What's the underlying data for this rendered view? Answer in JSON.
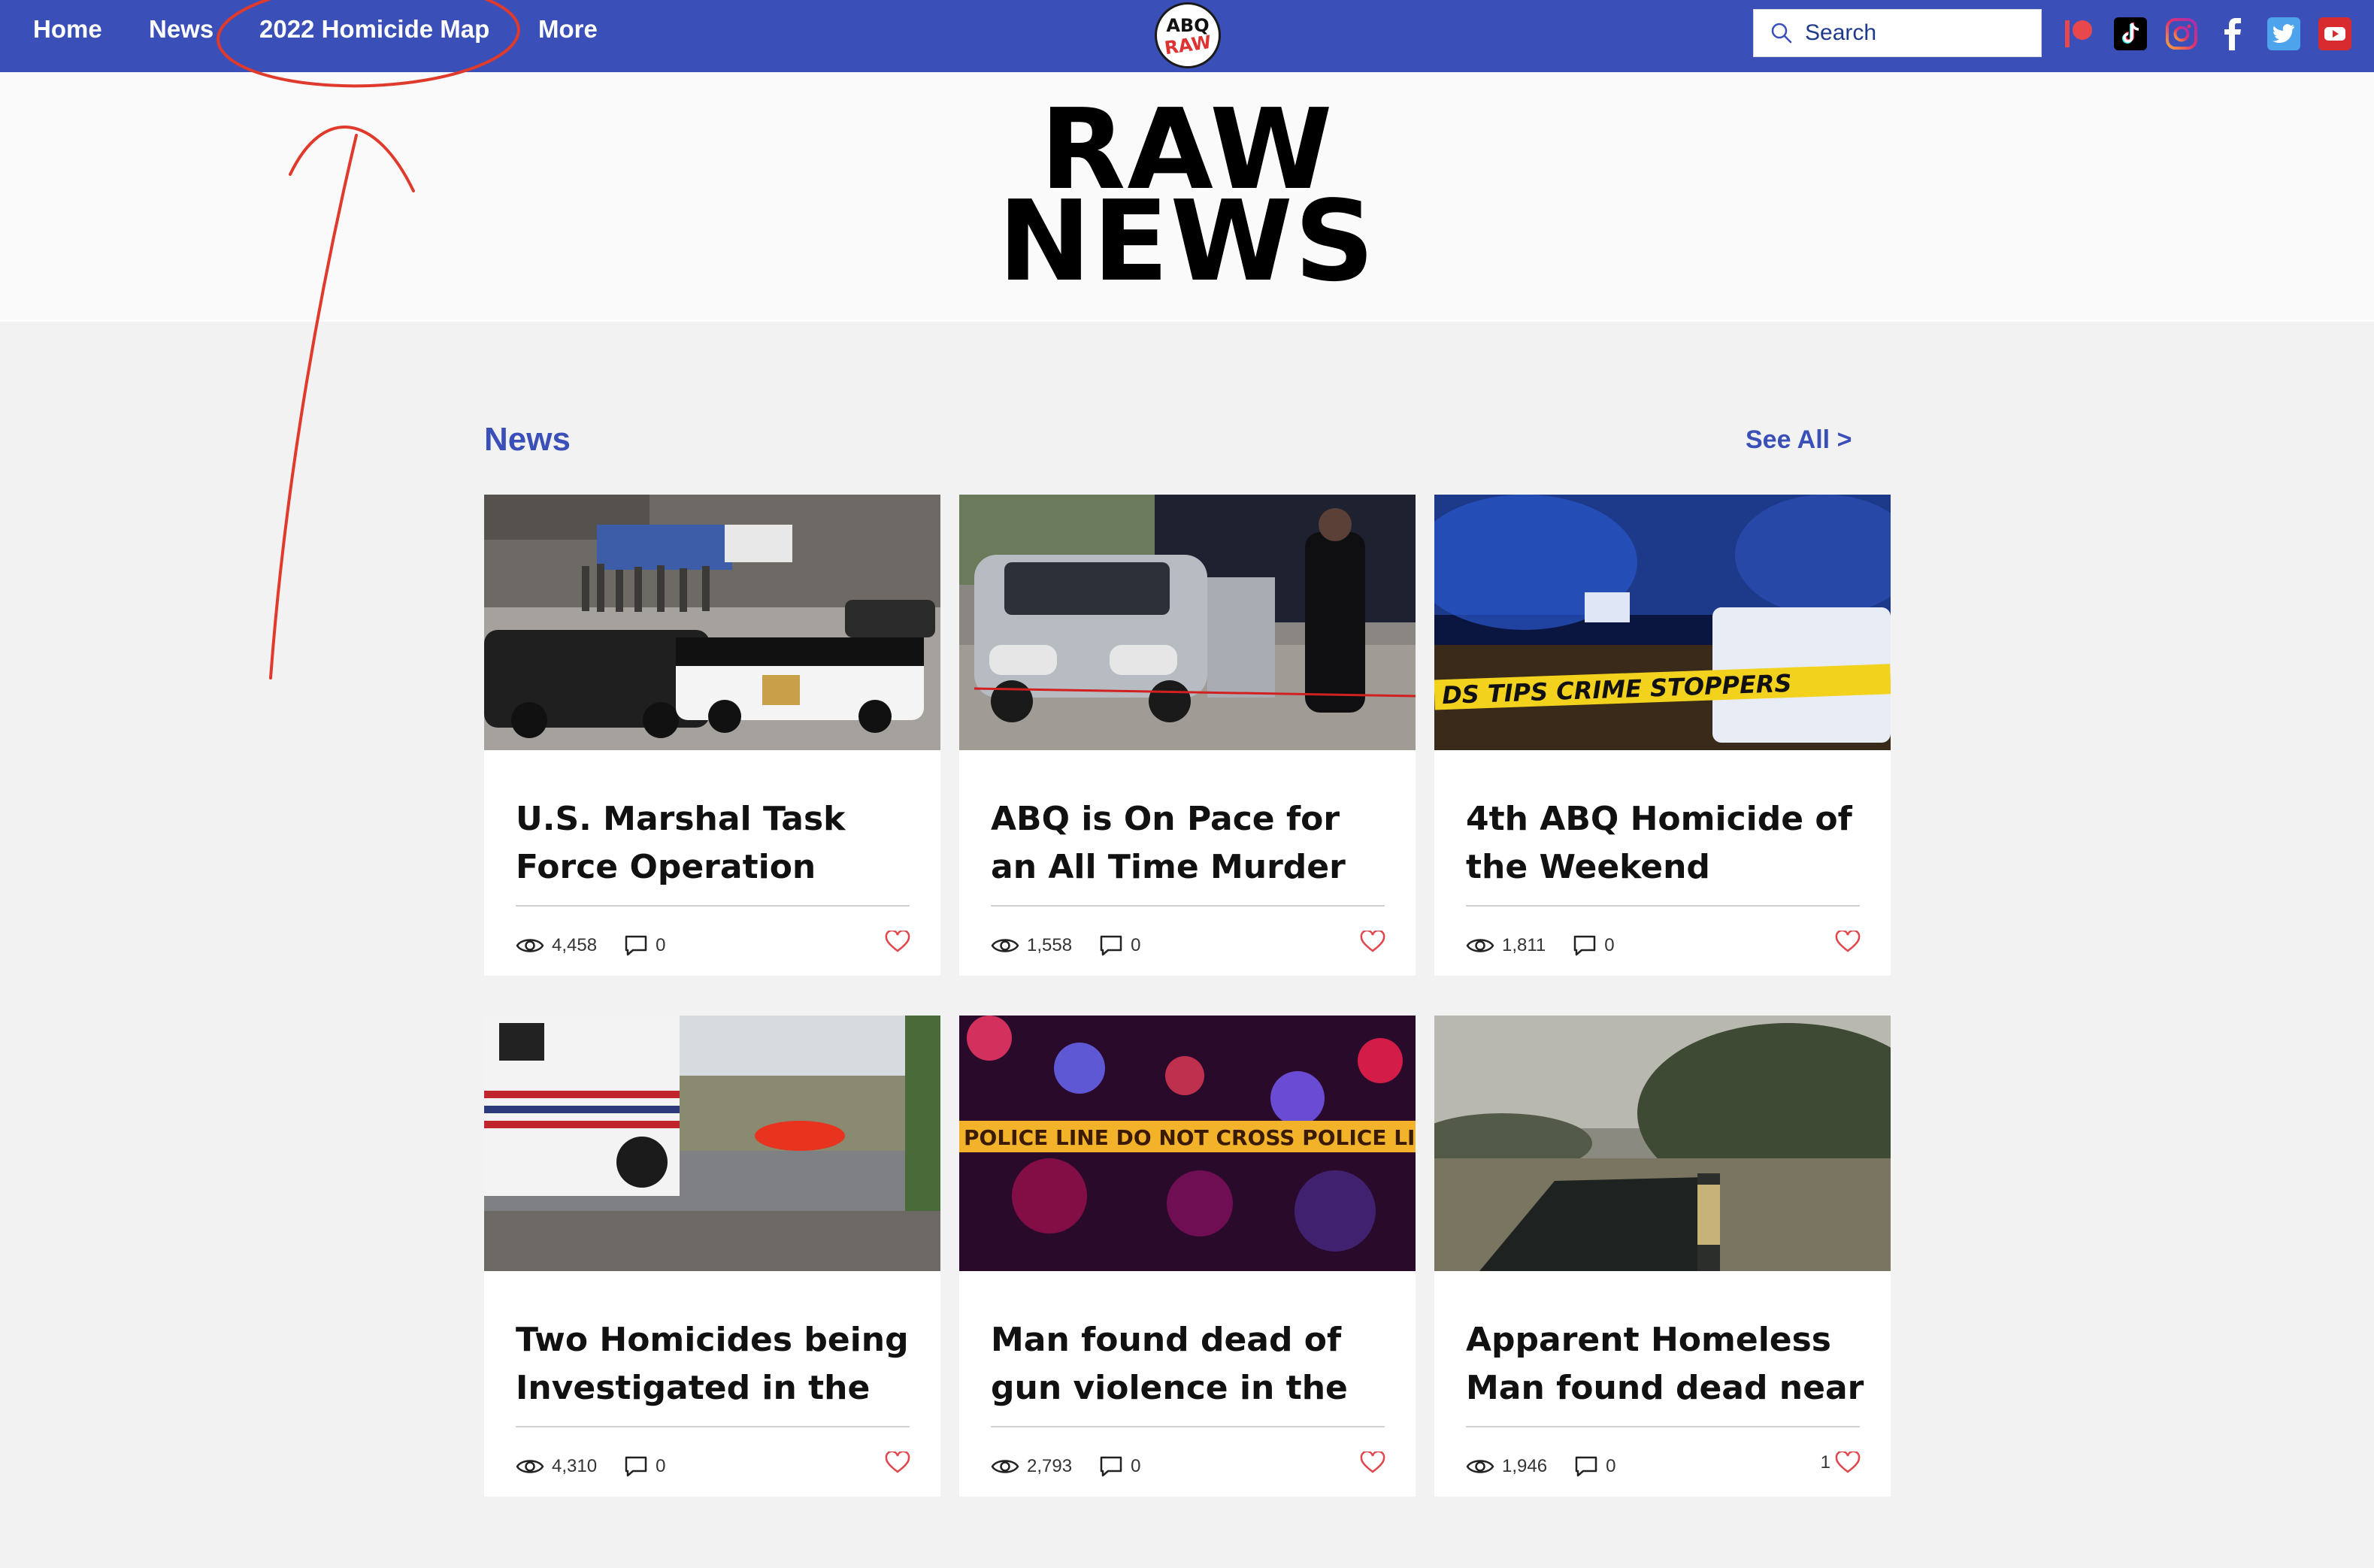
{
  "nav": {
    "items": [
      "Home",
      "News",
      "2022 Homicide Map",
      "More"
    ],
    "logo_line1": "ABQ",
    "logo_line2": "RAW"
  },
  "search": {
    "placeholder": "Search"
  },
  "social_icons": [
    "patreon-icon",
    "tiktok-icon",
    "instagram-icon",
    "facebook-icon",
    "twitter-icon",
    "youtube-icon"
  ],
  "header": {
    "title_line1": "RAW",
    "title_line2": "NEWS"
  },
  "section": {
    "title": "News",
    "see_all": "See All >"
  },
  "posts": [
    {
      "title": "U.S. Marshal Task Force Operation",
      "views": "4,458",
      "comments": "0",
      "likes": ""
    },
    {
      "title": "ABQ is On Pace for an All Time Murder Rate",
      "views": "1,558",
      "comments": "0",
      "likes": ""
    },
    {
      "title": "4th ABQ Homicide of the Weekend",
      "views": "1,811",
      "comments": "0",
      "likes": ""
    },
    {
      "title": "Two Homicides being Investigated in the SW",
      "views": "4,310",
      "comments": "0",
      "likes": ""
    },
    {
      "title": "Man found dead of gun violence in the",
      "views": "2,793",
      "comments": "0",
      "likes": ""
    },
    {
      "title": "Apparent Homeless Man found dead near",
      "views": "1,946",
      "comments": "0",
      "likes": "1"
    }
  ],
  "colors": {
    "nav_bg": "#3a50b8",
    "accent": "#3a50b8",
    "heart": "#e0474c",
    "annotation": "#e03a2c"
  }
}
